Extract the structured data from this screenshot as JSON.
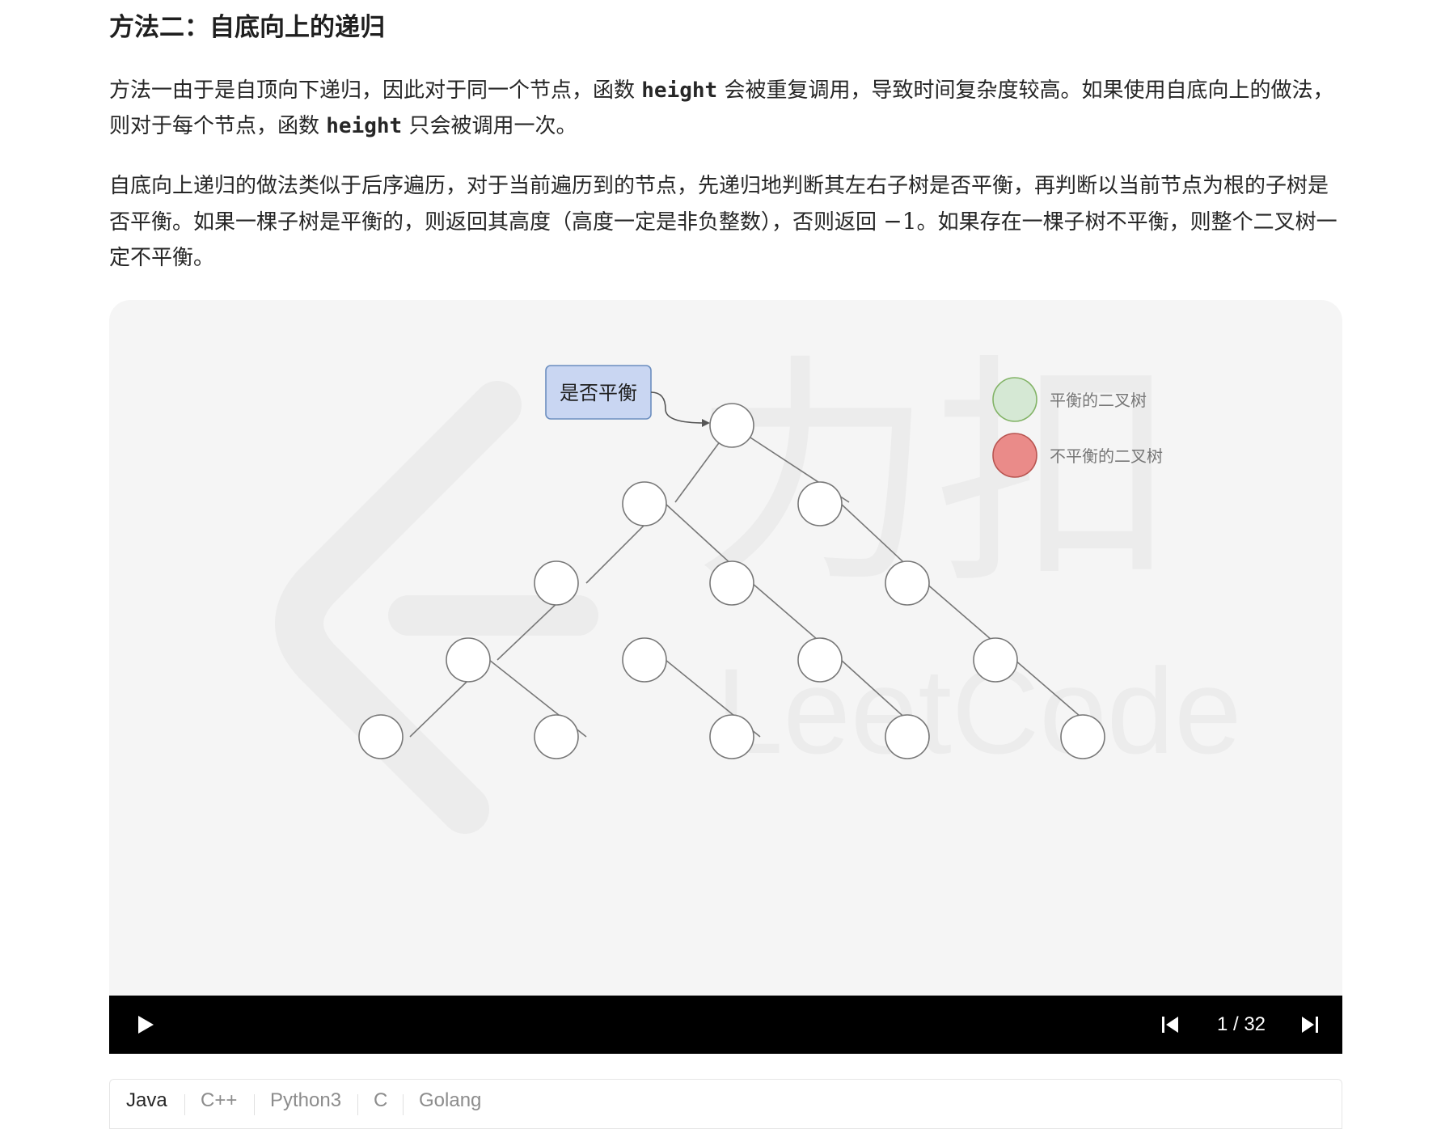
{
  "section_title": "方法二：自底向上的递归",
  "paragraph1": {
    "pre": "方法一由于是自顶向下递归，因此对于同一个节点，函数 ",
    "code1": "height",
    "mid": " 会被重复调用，导致时间复杂度较高。如果使用自底向上的做法，则对于每个节点，函数 ",
    "code2": "height",
    "post": " 只会被调用一次。"
  },
  "paragraph2": {
    "pre": "自底向上递归的做法类似于后序遍历，对于当前遍历到的节点，先递归地判断其左右子树是否平衡，再判断以当前节点为根的子树是否平衡。如果一棵子树是平衡的，则返回其高度（高度一定是非负整数），否则返回 ",
    "math": "−1",
    "post": "。如果存在一棵子树不平衡，则整个二叉树一定不平衡。"
  },
  "diagram": {
    "callout_label": "是否平衡",
    "legend": [
      {
        "label": "平衡的二叉树",
        "color": "#d5e8d4",
        "stroke": "#82b366"
      },
      {
        "label": "不平衡的二叉树",
        "color": "#ea8b89",
        "stroke": "#b85450"
      }
    ],
    "watermark_text": "LeetCode",
    "watermark_cn": "力扣",
    "node_fill": "#ffffff",
    "node_stroke": "#666666",
    "callout_fill": "#c9d6f2",
    "callout_stroke": "#6c8ebf"
  },
  "player": {
    "current_frame": "1",
    "total_frames": "32",
    "counter_text": "1 / 32",
    "play_icon": "play-icon",
    "prev_icon": "skip-previous-icon",
    "next_icon": "skip-next-icon"
  },
  "code_tabs": {
    "items": [
      "Java",
      "C++",
      "Python3",
      "C",
      "Golang"
    ],
    "active": "Java"
  }
}
